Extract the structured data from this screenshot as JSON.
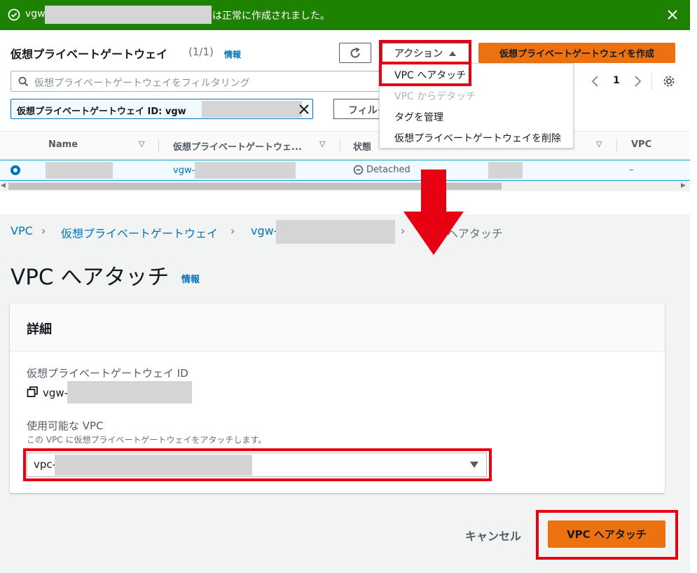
{
  "banner": {
    "id_prefix": "vgw-",
    "message": "は正常に作成されました。"
  },
  "list": {
    "title": "仮想プライベートゲートウェイ",
    "count": "(1/1)",
    "info": "情報",
    "actions_label": "アクション",
    "create_label": "仮想プライベートゲートウェイを作成",
    "filter_placeholder": "仮想プライベートゲートウェイをフィルタリング",
    "token_label": "仮想プライベートゲートウェイ ID: vgw",
    "filter_button": "フィルター",
    "page": "1",
    "columns": [
      "Name",
      "仮想プライベートゲートウェ...",
      "状態",
      "VPC"
    ],
    "row": {
      "vgw": "vgw-",
      "state": "Detached",
      "vpc": "–"
    }
  },
  "actions_menu": [
    {
      "label": "VPC へアタッチ",
      "enabled": true
    },
    {
      "label": "VPC からデタッチ",
      "enabled": false
    },
    {
      "label": "タグを管理",
      "enabled": true
    },
    {
      "label": "仮想プライベートゲートウェイを削除",
      "enabled": true
    }
  ],
  "attach_page": {
    "breadcrumb": [
      "VPC",
      "仮想プライベートゲートウェイ",
      "vgw-",
      "VPC へアタッチ"
    ],
    "title": "VPC へアタッチ",
    "info": "情報",
    "section": "詳細",
    "gateway_id_label": "仮想プライベートゲートウェイ ID",
    "gateway_id_value": "vgw-",
    "vpc_label": "使用可能な VPC",
    "vpc_description": "この VPC に仮想プライベートゲートウェイをアタッチします。",
    "vpc_value": "vpc-",
    "cancel": "キャンセル",
    "submit": "VPC へアタッチ"
  },
  "colors": {
    "success": "#1d8102",
    "primary": "#ec7211",
    "link": "#0073bb",
    "highlight": "#e60012"
  },
  "icons": [
    "success-icon",
    "close-icon",
    "refresh-icon",
    "search-icon",
    "gear-icon",
    "copy-icon",
    "arrow-down-icon"
  ]
}
